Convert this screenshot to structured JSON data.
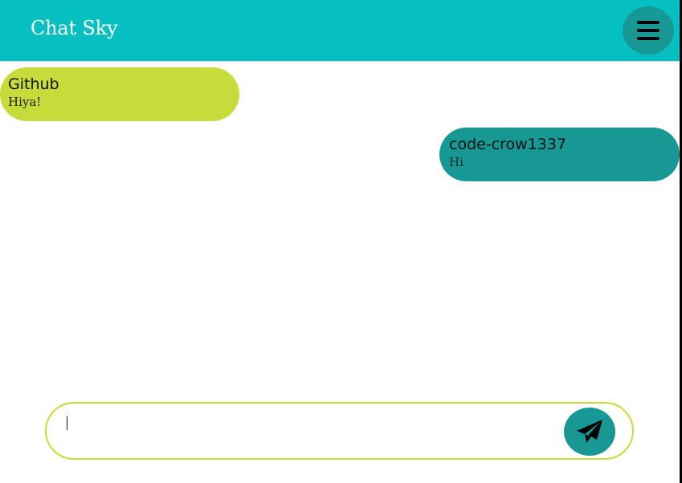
{
  "app": {
    "title": "Chat Sky",
    "header_color": "#06bfc1",
    "accent_color": "#179895",
    "highlight_color": "#c7db3a"
  },
  "header": {
    "menu_icon": "hamburger-menu-icon"
  },
  "messages": [
    {
      "sender": "Github",
      "text": "Hiya!",
      "direction": "incoming"
    },
    {
      "sender": "code-crow1337",
      "text": "Hi",
      "direction": "outgoing"
    }
  ],
  "composer": {
    "value": "",
    "placeholder": "",
    "send_icon": "paper-plane-icon"
  }
}
